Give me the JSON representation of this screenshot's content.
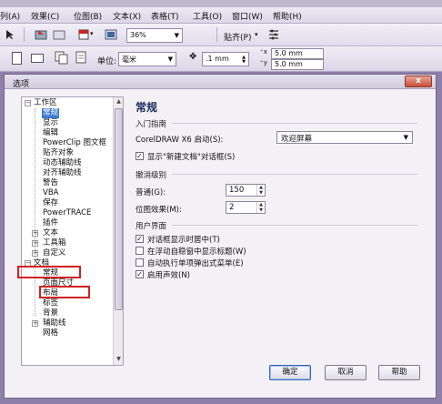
{
  "menubar": {
    "items": [
      "列(A)",
      "效果(C)",
      "位图(B)",
      "文本(X)",
      "表格(T)",
      "工具(O)",
      "窗口(W)",
      "帮助(H)"
    ]
  },
  "toolbar": {
    "zoom": "36%",
    "snap": "贴齐(P)",
    "units_label": "单位:",
    "units_value": "毫米",
    "nudge": ".1 mm",
    "dup_x": "5.0 mm",
    "dup_y": "5.0 mm"
  },
  "dialog": {
    "title": "选项",
    "close": "x",
    "tree": {
      "items": [
        "工作区",
        "常规",
        "显示",
        "编辑",
        "PowerClip 图文框",
        "贴齐对象",
        "动态辅助线",
        "对齐辅助线",
        "警告",
        "VBA",
        "保存",
        "PowerTRACE",
        "插件",
        "文本",
        "工具箱",
        "自定义",
        "文档",
        "常规",
        "页面尺寸",
        "布局",
        "标签",
        "背景",
        "辅助线",
        "网格"
      ]
    },
    "panel": {
      "title": "常规",
      "startup_section": "入门指南",
      "startup_label": "CorelDRAW X6 启动(S):",
      "startup_value": "欢迎屏幕",
      "show_new_doc": "显示\"新建文档\"对话框(S)",
      "undo_section": "撤消级别",
      "normal_label": "普通(G):",
      "normal_value": "150",
      "bitmap_label": "位图效果(M):",
      "bitmap_value": "2",
      "ui_section": "用户界面",
      "cb1": "对话框显示时居中(T)",
      "cb2": "在浮动自稳窗中显示标题(W)",
      "cb3": "自动执行单项弹出式菜单(E)",
      "cb4": "启用声效(N)"
    },
    "buttons": {
      "ok": "确定",
      "cancel": "取消",
      "help": "帮助"
    }
  }
}
